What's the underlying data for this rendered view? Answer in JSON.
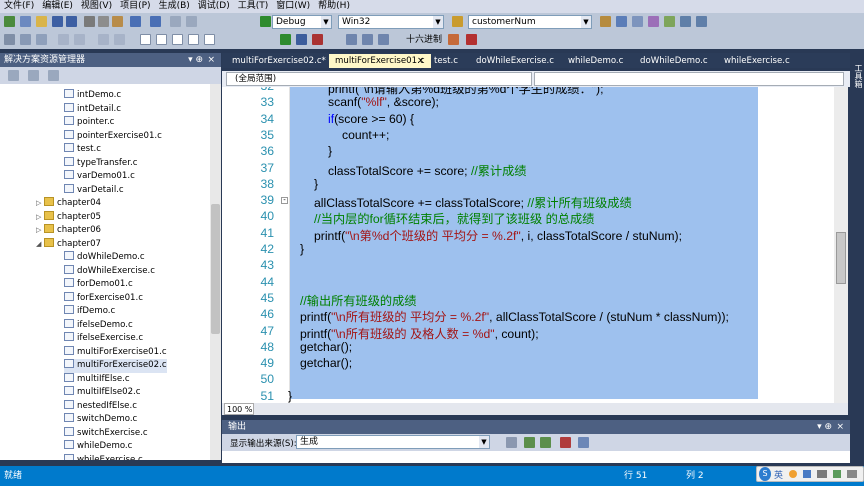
{
  "menu": [
    "文件(F)",
    "编辑(E)",
    "视图(V)",
    "项目(P)",
    "生成(B)",
    "调试(D)",
    "工具(T)",
    "窗口(W)",
    "帮助(H)"
  ],
  "toolbar": {
    "config": "Debug",
    "platform": "Win32",
    "find_value": "customerNum",
    "hex_label": "十六进制"
  },
  "solution_explorer": {
    "title": "解决方案资源管理器",
    "items": [
      {
        "label": "intDemo.c",
        "type": "file"
      },
      {
        "label": "intDetail.c",
        "type": "file"
      },
      {
        "label": "pointer.c",
        "type": "file"
      },
      {
        "label": "pointerExercise01.c",
        "type": "file"
      },
      {
        "label": "test.c",
        "type": "file"
      },
      {
        "label": "typeTransfer.c",
        "type": "file"
      },
      {
        "label": "varDemo01.c",
        "type": "file"
      },
      {
        "label": "varDetail.c",
        "type": "file"
      },
      {
        "label": "chapter04",
        "type": "folder"
      },
      {
        "label": "chapter05",
        "type": "folder"
      },
      {
        "label": "chapter06",
        "type": "folder"
      },
      {
        "label": "chapter07",
        "type": "folder-open"
      },
      {
        "label": "doWhileDemo.c",
        "type": "file"
      },
      {
        "label": "doWhileExercise.c",
        "type": "file"
      },
      {
        "label": "forDemo01.c",
        "type": "file"
      },
      {
        "label": "forExercise01.c",
        "type": "file"
      },
      {
        "label": "ifDemo.c",
        "type": "file"
      },
      {
        "label": "ifelseDemo.c",
        "type": "file"
      },
      {
        "label": "ifelseExercise.c",
        "type": "file"
      },
      {
        "label": "multiForExercise01.c",
        "type": "file"
      },
      {
        "label": "multiForExercise02.c",
        "type": "file",
        "selected": true
      },
      {
        "label": "multiIfElse.c",
        "type": "file"
      },
      {
        "label": "multiIfElse02.c",
        "type": "file"
      },
      {
        "label": "nestedIfElse.c",
        "type": "file"
      },
      {
        "label": "switchDemo.c",
        "type": "file"
      },
      {
        "label": "switchExercise.c",
        "type": "file"
      },
      {
        "label": "whileDemo.c",
        "type": "file"
      },
      {
        "label": "whileExercise.c",
        "type": "file"
      }
    ]
  },
  "tabs": [
    {
      "label": "multiForExercise02.c*",
      "active": false
    },
    {
      "label": "multiForExercise01.c",
      "active": true
    },
    {
      "label": "test.c",
      "active": false
    },
    {
      "label": "doWhileExercise.c",
      "active": false
    },
    {
      "label": "whileDemo.c",
      "active": false
    },
    {
      "label": "doWhileDemo.c",
      "active": false
    },
    {
      "label": "whileExercise.c",
      "active": false
    }
  ],
  "navbar": {
    "scope": "(全局范围)"
  },
  "editor": {
    "zoom": "100 %",
    "lines": [
      {
        "num": "32",
        "tokens": [
          {
            "t": "printf(\"\\n请输入第%d班级的第%d个学生的成绩：\");",
            "c": "plain"
          }
        ]
      },
      {
        "num": "33",
        "tokens": [
          {
            "t": "scanf(",
            "c": "plain"
          },
          {
            "t": "\"%lf\"",
            "c": "str"
          },
          {
            "t": ", &score);",
            "c": "plain"
          }
        ]
      },
      {
        "num": "34",
        "tokens": [
          {
            "t": "if",
            "c": "kw"
          },
          {
            "t": "(score >= 60) {",
            "c": "plain"
          }
        ]
      },
      {
        "num": "35",
        "tokens": [
          {
            "t": "count++;",
            "c": "plain"
          }
        ]
      },
      {
        "num": "36",
        "tokens": [
          {
            "t": "}",
            "c": "plain"
          }
        ]
      },
      {
        "num": "37",
        "tokens": [
          {
            "t": "classTotalScore += score; ",
            "c": "plain"
          },
          {
            "t": "//累计成绩",
            "c": "cm"
          }
        ]
      },
      {
        "num": "38",
        "tokens": [
          {
            "t": "}",
            "c": "plain"
          }
        ]
      },
      {
        "num": "39",
        "tokens": [
          {
            "t": "allClassTotalScore += classTotalScore; ",
            "c": "plain"
          },
          {
            "t": "//累计所有班级成绩",
            "c": "cm"
          }
        ]
      },
      {
        "num": "40",
        "tokens": [
          {
            "t": "//当内层的for循环结束后，就得到了该班级 的总成绩",
            "c": "cm"
          }
        ]
      },
      {
        "num": "41",
        "tokens": [
          {
            "t": "printf(",
            "c": "plain"
          },
          {
            "t": "\"\\n第%d个班级的 平均分 = %.2f\"",
            "c": "str"
          },
          {
            "t": ", i, classTotalScore / stuNum);",
            "c": "plain"
          }
        ]
      },
      {
        "num": "42",
        "tokens": [
          {
            "t": "}",
            "c": "plain"
          }
        ]
      },
      {
        "num": "43",
        "tokens": []
      },
      {
        "num": "44",
        "tokens": []
      },
      {
        "num": "45",
        "tokens": [
          {
            "t": "//输出所有班级的成绩",
            "c": "cm"
          }
        ]
      },
      {
        "num": "46",
        "tokens": [
          {
            "t": "printf(",
            "c": "plain"
          },
          {
            "t": "\"\\n所有班级的 平均分 = %.2f\"",
            "c": "str"
          },
          {
            "t": ", allClassTotalScore / (stuNum * classNum));",
            "c": "plain"
          }
        ]
      },
      {
        "num": "47",
        "tokens": [
          {
            "t": "printf(",
            "c": "plain"
          },
          {
            "t": "\"\\n所有班级的 及格人数 = %d\"",
            "c": "str"
          },
          {
            "t": ", count);",
            "c": "plain"
          }
        ]
      },
      {
        "num": "48",
        "tokens": [
          {
            "t": "getchar();",
            "c": "plain"
          }
        ]
      },
      {
        "num": "49",
        "tokens": [
          {
            "t": "getchar();",
            "c": "plain"
          }
        ]
      },
      {
        "num": "50",
        "tokens": []
      },
      {
        "num": "51",
        "tokens": [
          {
            "t": "}",
            "c": "plain"
          }
        ]
      }
    ]
  },
  "output": {
    "title": "输出",
    "source_label": "显示输出来源(S):",
    "source_value": "生成"
  },
  "status": {
    "left": "就绪",
    "row": "行 51",
    "col": "列 2"
  },
  "ime": {
    "lang": "英"
  },
  "right_strip": "工具箱"
}
